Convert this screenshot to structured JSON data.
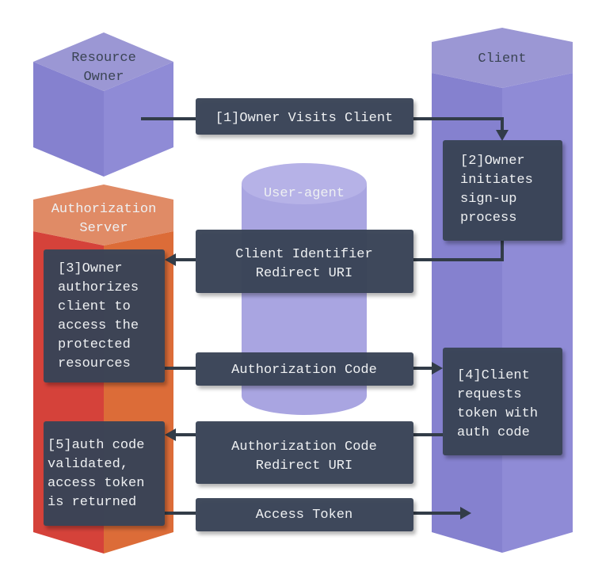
{
  "actors": {
    "resource_owner": [
      "Resource",
      "Owner"
    ],
    "authorization_server": [
      "Authorization",
      "Server"
    ],
    "client": "Client",
    "user_agent": "User-agent"
  },
  "steps": {
    "s1": "[1]Owner Visits Client",
    "s2": [
      "[2]Owner",
      "initiates",
      "sign-up",
      "process"
    ],
    "s3": [
      "[3]Owner",
      "authorizes",
      "client to",
      "access the",
      "protected",
      "resources"
    ],
    "s4": [
      "[4]Client",
      "requests",
      "token with",
      "auth code"
    ],
    "s5": [
      "[5]auth code",
      "validated,",
      "access token",
      "is returned"
    ]
  },
  "messages": {
    "client_identifier": [
      "Client Identifier",
      "Redirect URI"
    ],
    "authorization_code": "Authorization Code",
    "auth_code_redirect": [
      "Authorization Code",
      "Redirect URI"
    ],
    "access_token": "Access Token"
  },
  "colors": {
    "purple_top": "#9b97d4",
    "purple_left": "#8581cf",
    "purple_right": "#8f8bd6",
    "orange_top": "#e08b66",
    "orange_left": "#d5423a",
    "orange_right": "#dc6c38",
    "cylinder": "#a9a5e1",
    "box": "#3a4556"
  }
}
